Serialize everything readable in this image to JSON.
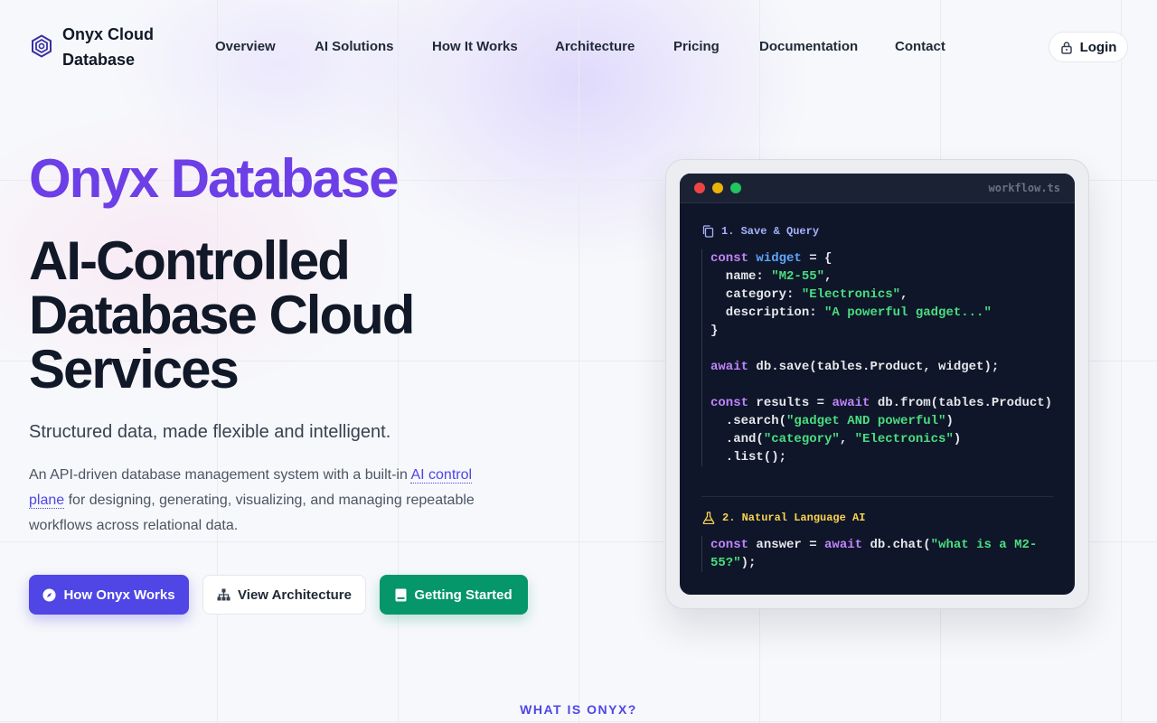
{
  "header": {
    "logo_line1": "Onyx Cloud",
    "logo_line2": "Database",
    "nav": [
      "Overview",
      "AI Solutions",
      "How It Works",
      "Architecture",
      "Pricing",
      "Documentation",
      "Contact"
    ],
    "login_label": "Login",
    "login_icon": "lock-icon"
  },
  "hero": {
    "brand_title": "Onyx Database",
    "headline": "AI-Controlled Database Cloud Services",
    "subline": "Structured data, made flexible and intelligent.",
    "desc_before": "An API-driven database management system with a built-in ",
    "desc_link": "AI control plane",
    "desc_after": " for designing, generating, visualizing, and managing repeatable workflows across relational data.",
    "cta": {
      "primary": "How Onyx Works",
      "secondary": "View Architecture",
      "green": "Getting Started"
    }
  },
  "code_window": {
    "filename": "workflow.ts",
    "section1_label": "1. Save & Query",
    "section2_label": "2. Natural Language AI",
    "colors": {
      "keyword": "#c084fc",
      "variable": "#60a5fa",
      "string": "#4ade80",
      "section1": "#a5b4fc",
      "section2": "#fcd34d",
      "dot_red": "#ef4444",
      "dot_yellow": "#eab308",
      "dot_green": "#22c55e"
    }
  },
  "next_section_kicker": "WHAT IS ONYX?",
  "colors": {
    "accent": "#4f46e5",
    "brand_purple": "#6d3fe6",
    "green": "#059669"
  }
}
